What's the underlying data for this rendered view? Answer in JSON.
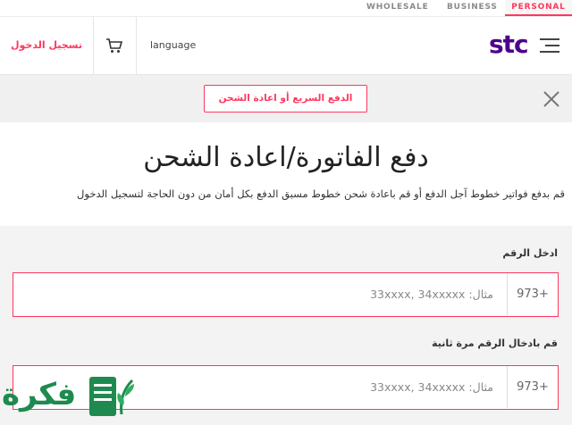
{
  "segments": {
    "wholesale": "WHOLESALE",
    "business": "BUSINESS",
    "personal": "PERSONAL"
  },
  "header": {
    "login_label": "تسجيل الدخول",
    "language_label": "language",
    "logo_text": "stc"
  },
  "banner": {
    "quick_pay_label": "الدفع السريع أو اعادة الشحن"
  },
  "main": {
    "title": "دفع الفاتورة/اعادة الشحن",
    "subtitle": "قم بدفع فواتير خطوط آجل الدفع أو قم باعادة شحن خطوط مسبق الدفع بكل أمان من دون الحاجة لتسجيل الدخول"
  },
  "form": {
    "number_label": "ادخل الرقم",
    "confirm_label": "قم بادخال الرقم مرة ثانية",
    "country_code": "973+",
    "placeholder": "مثال: 33xxxx, 34xxxxx"
  },
  "watermark": {
    "text": "فكرة"
  },
  "colors": {
    "accent": "#ff375e",
    "brand": "#4f008c",
    "watermark": "#1e8a4f"
  }
}
